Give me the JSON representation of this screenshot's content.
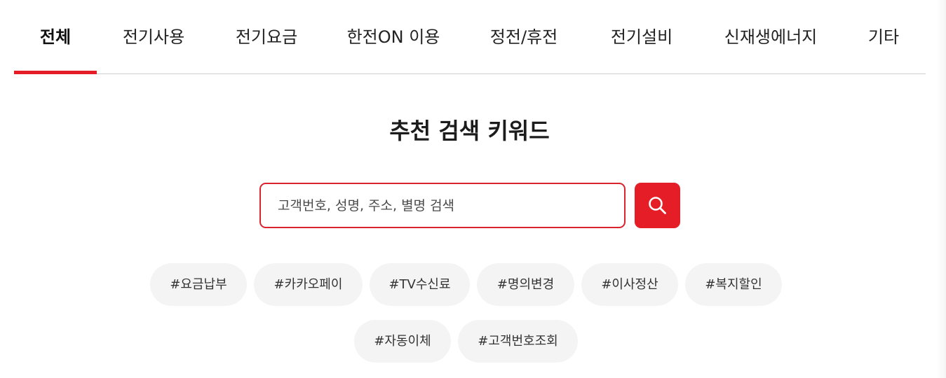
{
  "tabs": [
    {
      "label": "전체",
      "active": true
    },
    {
      "label": "전기사용",
      "active": false
    },
    {
      "label": "전기요금",
      "active": false
    },
    {
      "label": "한전ON 이용",
      "active": false
    },
    {
      "label": "정전/휴전",
      "active": false
    },
    {
      "label": "전기설비",
      "active": false
    },
    {
      "label": "신재생에너지",
      "active": false
    },
    {
      "label": "기타",
      "active": false
    }
  ],
  "heading": "추천 검색 키워드",
  "search": {
    "placeholder": "고객번호, 성명, 주소, 별명 검색",
    "value": "",
    "button_icon": "search-icon"
  },
  "keywords": [
    "#요금납부",
    "#카카오페이",
    "#TV수신료",
    "#명의변경",
    "#이사정산",
    "#복지할인",
    "#자동이체",
    "#고객번호조회"
  ],
  "colors": {
    "accent": "#e51d26",
    "chip_bg": "#f4f4f4",
    "divider": "#cfcfcf"
  }
}
